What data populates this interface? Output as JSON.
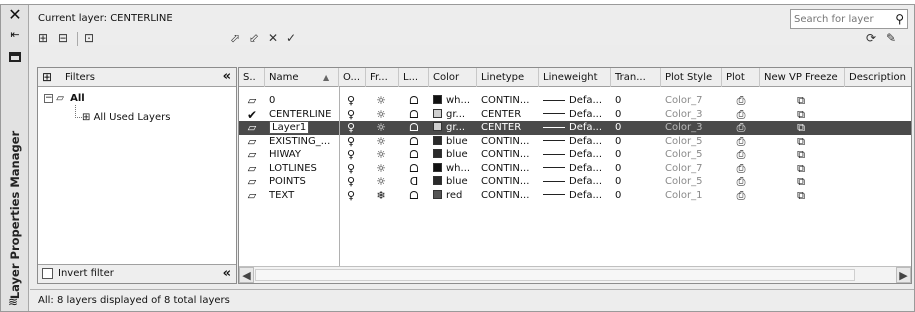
{
  "window": {
    "title": "Layer Properties Manager",
    "close_glyph": "✕",
    "autohide_glyph": "⇤"
  },
  "header": {
    "current_layer": "Current layer: CENTERLINE",
    "search_placeholder": "Search for layer"
  },
  "toolbar_left": [
    "new-property-filter-icon",
    "new-group-filter-icon",
    "layer-states-manager-icon"
  ],
  "toolbar_right": [
    "new-layer-icon",
    "new-layer-vp-frozen-icon",
    "delete-layer-icon",
    "set-current-icon"
  ],
  "toolbar_far_right": [
    "refresh-icon",
    "settings-icon"
  ],
  "filters": {
    "header": "Filters",
    "collapse_glyph": "«",
    "tree": [
      {
        "label": "All",
        "expanded": true
      },
      {
        "label": "All Used Layers"
      }
    ],
    "invert_filter_label": "Invert filter"
  },
  "columns": [
    "S..",
    "Name",
    "O...",
    "Fr...",
    "L...",
    "Color",
    "Linetype",
    "Lineweight",
    "Tran...",
    "Plot Style",
    "Plot",
    "New VP Freeze",
    "Description"
  ],
  "layers": [
    {
      "name": "0",
      "current": false,
      "selected": false,
      "color_swatch": "#111111",
      "color": "wh...",
      "linetype": "CONTIN...",
      "lineweight": "Defa...",
      "transparency": "0",
      "plot_style": "Color_7",
      "frozen": false,
      "locked": false
    },
    {
      "name": "CENTERLINE",
      "current": true,
      "selected": false,
      "color_swatch": "#cfcfcf",
      "color": "gr...",
      "linetype": "CENTER",
      "lineweight": "Defa...",
      "transparency": "0",
      "plot_style": "Color_3",
      "frozen": false,
      "locked": false
    },
    {
      "name": "Layer1",
      "current": false,
      "selected": true,
      "color_swatch": "#cfcfcf",
      "color": "gr...",
      "linetype": "CENTER",
      "lineweight": "Defa...",
      "transparency": "0",
      "plot_style": "Color_3",
      "frozen": false,
      "locked": false
    },
    {
      "name": "EXISTING_...",
      "current": false,
      "selected": false,
      "color_swatch": "#2a2a2a",
      "color": "blue",
      "linetype": "CONTIN...",
      "lineweight": "Defa...",
      "transparency": "0",
      "plot_style": "Color_5",
      "frozen": false,
      "locked": false
    },
    {
      "name": "HIWAY",
      "current": false,
      "selected": false,
      "color_swatch": "#2a2a2a",
      "color": "blue",
      "linetype": "CONTIN...",
      "lineweight": "Defa...",
      "transparency": "0",
      "plot_style": "Color_5",
      "frozen": false,
      "locked": false
    },
    {
      "name": "LOTLINES",
      "current": false,
      "selected": false,
      "color_swatch": "#111111",
      "color": "wh...",
      "linetype": "CONTIN...",
      "lineweight": "Defa...",
      "transparency": "0",
      "plot_style": "Color_7",
      "frozen": false,
      "locked": false
    },
    {
      "name": "POINTS",
      "current": false,
      "selected": false,
      "color_swatch": "#2a2a2a",
      "color": "blue",
      "linetype": "CONTIN...",
      "lineweight": "Defa...",
      "transparency": "0",
      "plot_style": "Color_5",
      "frozen": false,
      "locked": true
    },
    {
      "name": "TEXT",
      "current": false,
      "selected": false,
      "color_swatch": "#555555",
      "color": "red",
      "linetype": "CONTIN...",
      "lineweight": "Defa...",
      "transparency": "0",
      "plot_style": "Color_1",
      "frozen": true,
      "locked": false
    }
  ],
  "status": "All: 8 layers displayed of 8 total layers"
}
